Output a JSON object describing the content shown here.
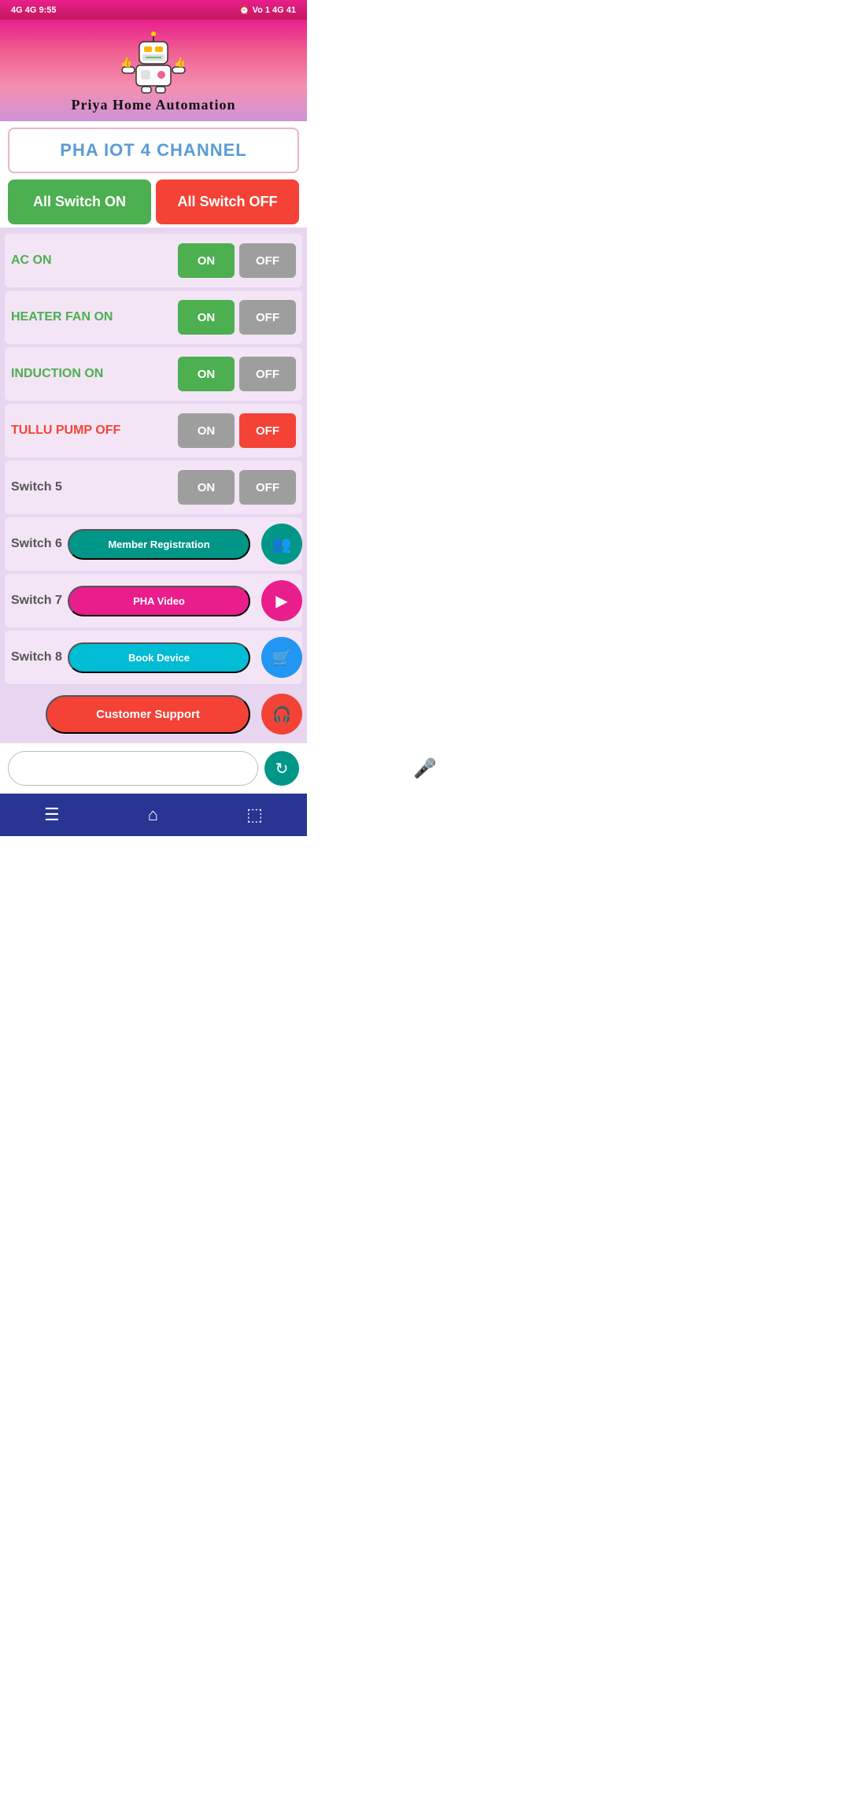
{
  "statusBar": {
    "left": "4G  4G   9:55",
    "right": "⏰ Vo 1 4G  41"
  },
  "brandTitle": "Priya Home Automation",
  "channelTitle": "PHA IOT 4 CHANNEL",
  "allSwitchOn": "All Switch ON",
  "allSwitchOff": "All Switch OFF",
  "switches": [
    {
      "label": "AC ON",
      "labelColor": "green",
      "state": "on"
    },
    {
      "label": "HEATER FAN ON",
      "labelColor": "green",
      "state": "on"
    },
    {
      "label": "INDUCTION ON",
      "labelColor": "green",
      "state": "on"
    },
    {
      "label": "TULLU PUMP OFF",
      "labelColor": "red",
      "state": "off"
    },
    {
      "label": "Switch 5",
      "labelColor": "gray",
      "state": "off5"
    },
    {
      "label": "Switch 6",
      "labelColor": "gray",
      "state": "off6"
    },
    {
      "label": "Switch 7",
      "labelColor": "gray",
      "state": "off7"
    },
    {
      "label": "Switch 8",
      "labelColor": "gray",
      "state": "off8"
    }
  ],
  "onLabel": "ON",
  "offLabel": "OFF",
  "floatButtons": [
    {
      "label": "Member Registration",
      "colorClass": "banner-teal",
      "iconClass": "icon-teal",
      "icon": "👥"
    },
    {
      "label": "PHA Video",
      "colorClass": "banner-pink",
      "iconClass": "icon-pink",
      "icon": "▶"
    },
    {
      "label": "Book Device",
      "colorClass": "banner-cyan",
      "iconClass": "icon-blue",
      "icon": "🛒"
    },
    {
      "label": "Customer Support",
      "colorClass": "banner-orange",
      "iconClass": "icon-red",
      "icon": "🎧"
    }
  ],
  "inputPlaceholder": "",
  "navIcons": [
    "☰",
    "⌂",
    "⬜"
  ]
}
